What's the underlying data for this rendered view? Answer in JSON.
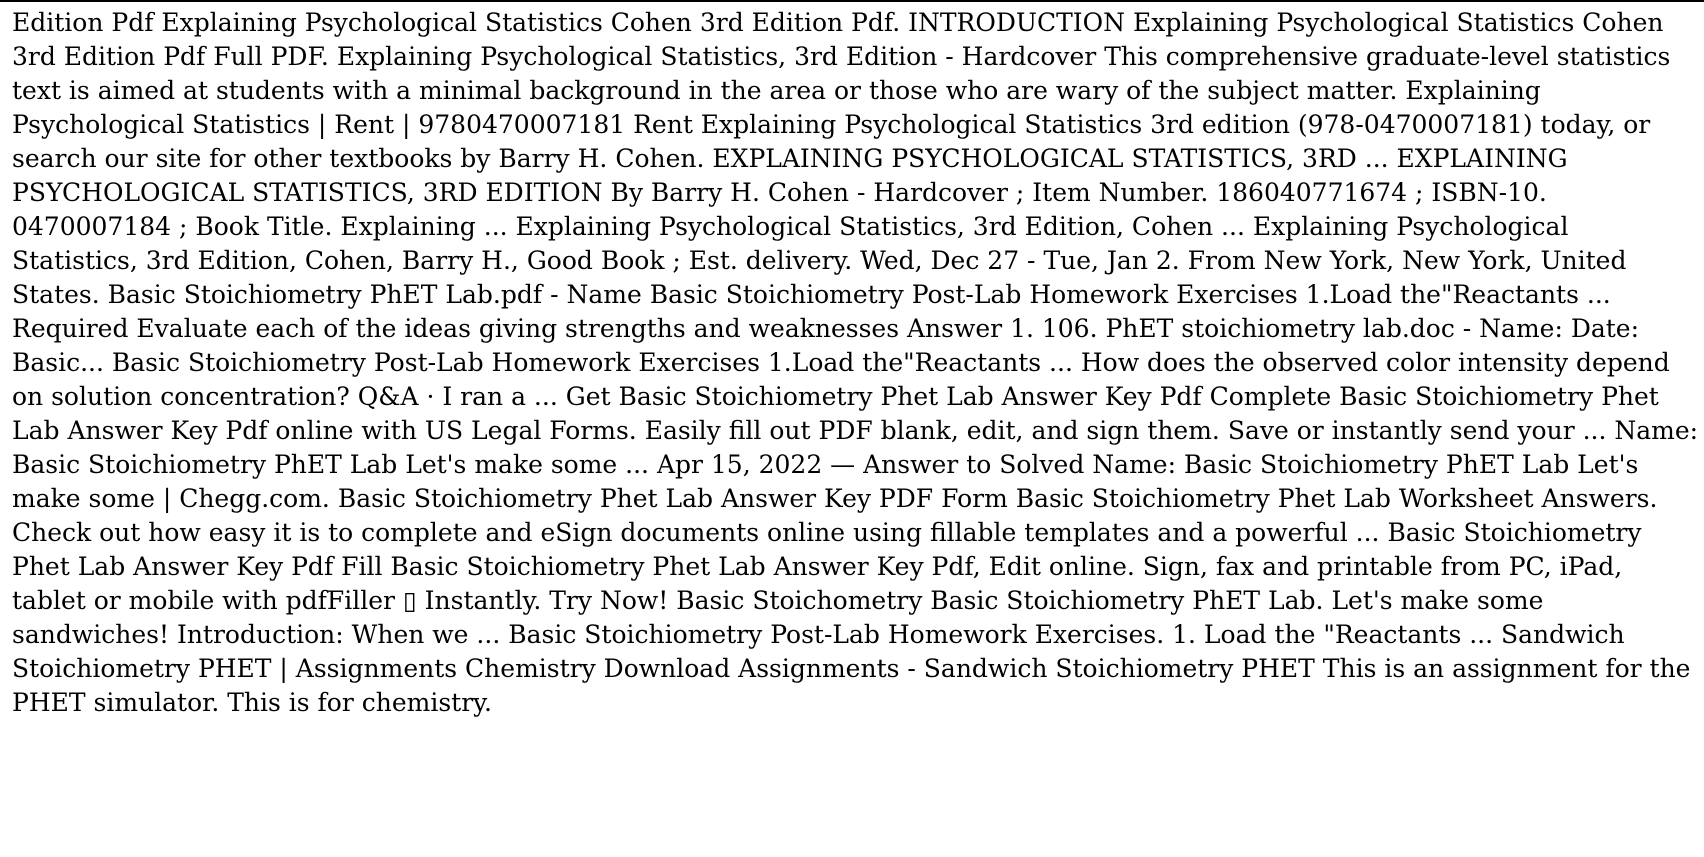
{
  "document": {
    "body_text": "Edition Pdf Explaining Psychological Statistics Cohen 3rd Edition Pdf. INTRODUCTION Explaining Psychological Statistics Cohen 3rd Edition Pdf Full PDF. Explaining Psychological Statistics, 3rd Edition - Hardcover This comprehensive graduate-level statistics text is aimed at students with a minimal background in the area or those who are wary of the subject matter. Explaining Psychological Statistics | Rent | 9780470007181 Rent Explaining Psychological Statistics 3rd edition (978-0470007181) today, or search our site for other textbooks by Barry H. Cohen. EXPLAINING PSYCHOLOGICAL STATISTICS, 3RD ... EXPLAINING PSYCHOLOGICAL STATISTICS, 3RD EDITION By Barry H. Cohen - Hardcover ; Item Number. 186040771674 ; ISBN-10. 0470007184 ; Book Title. Explaining ... Explaining Psychological Statistics, 3rd Edition, Cohen ... Explaining Psychological Statistics, 3rd Edition, Cohen, Barry H., Good Book ; Est. delivery. Wed, Dec 27 - Tue, Jan 2. From New York, New York, United States. Basic Stoichiometry PhET Lab.pdf - Name Basic Stoichiometry Post-Lab Homework Exercises 1.Load the\"Reactants ... Required Evaluate each of the ideas giving strengths and weaknesses Answer 1. 106. PhET stoichiometry lab.doc - Name: Date: Basic... Basic Stoichiometry Post-Lab Homework Exercises 1.Load the\"Reactants ... How does the observed color intensity depend on solution concentration? Q&A · I ran a ... Get Basic Stoichiometry Phet Lab Answer Key Pdf Complete Basic Stoichiometry Phet Lab Answer Key Pdf online with US Legal Forms. Easily fill out PDF blank, edit, and sign them. Save or instantly send your ... Name: Basic Stoichiometry PhET Lab Let's make some ... Apr 15, 2022 — Answer to Solved Name: Basic Stoichiometry PhET Lab Let's make some | Chegg.com. Basic Stoichiometry Phet Lab Answer Key PDF Form Basic Stoichiometry Phet Lab Worksheet Answers. Check out how easy it is to complete and eSign documents online using fillable templates and a powerful ... Basic Stoichiometry Phet Lab Answer Key Pdf Fill Basic Stoichiometry Phet Lab Answer Key Pdf, Edit online. Sign, fax and printable from PC, iPad, tablet or mobile with pdfFiller ▯ Instantly. Try Now! Basic Stoichometry Basic Stoichiometry PhET Lab. Let's make some sandwiches! Introduction: When we ... Basic Stoichiometry Post-Lab Homework Exercises. 1. Load the \"Reactants ... Sandwich Stoichiometry PHET | Assignments Chemistry Download Assignments - Sandwich Stoichiometry PHET This is an assignment for the PHET simulator. This is for chemistry."
  }
}
